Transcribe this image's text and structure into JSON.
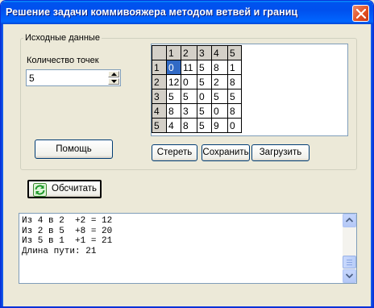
{
  "window": {
    "title": "Решение задачи коммивояжера методом ветвей и границ"
  },
  "input_group": {
    "legend": "Исходные данные",
    "count_label": "Количество точек",
    "count_value": "5"
  },
  "matrix": {
    "header": [
      "",
      "1",
      "2",
      "3",
      "4",
      "5"
    ],
    "rows": [
      [
        "1",
        "0",
        "11",
        "5",
        "8",
        "1"
      ],
      [
        "2",
        "12",
        "0",
        "5",
        "2",
        "8"
      ],
      [
        "3",
        "5",
        "5",
        "0",
        "5",
        "5"
      ],
      [
        "4",
        "8",
        "3",
        "5",
        "0",
        "8"
      ],
      [
        "5",
        "4",
        "8",
        "5",
        "9",
        "0"
      ]
    ]
  },
  "buttons": {
    "help": "Помощь",
    "clear": "Стереть",
    "save": "Сохранить",
    "load": "Загрузить",
    "calculate": "Обсчитать"
  },
  "output": {
    "lines": [
      "Из 4 в 2  +2 = 12",
      "Из 2 в 5  +8 = 20",
      "Из 5 в 1  +1 = 21",
      "Длина пути: 21"
    ]
  },
  "colors": {
    "titlebar": "#0054e3",
    "selection": "#316ac5"
  }
}
